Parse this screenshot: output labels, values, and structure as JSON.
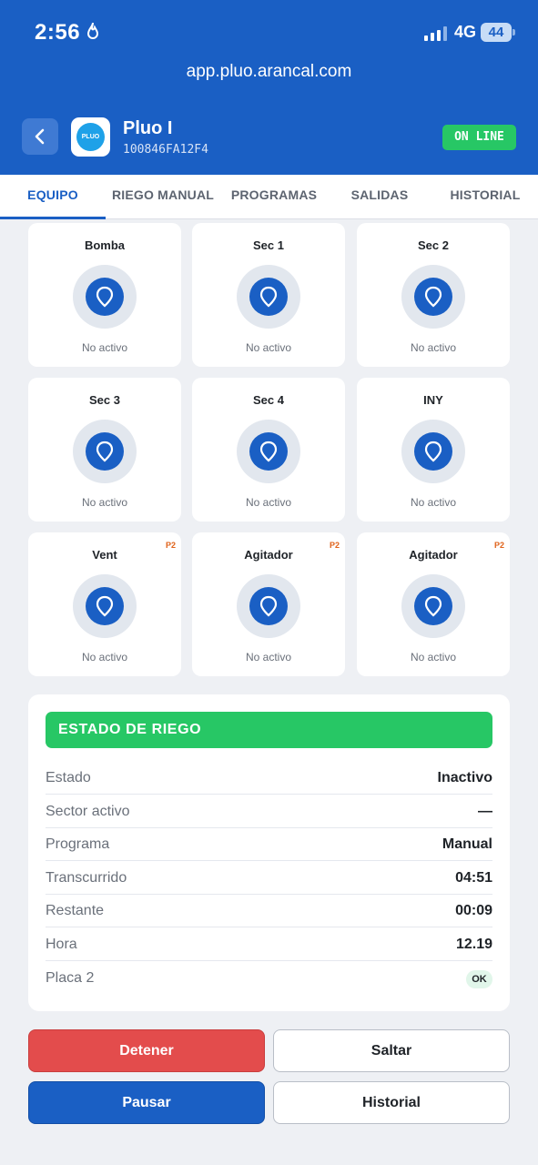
{
  "status_bar": {
    "time": "2:56",
    "network": "4G",
    "battery": "44"
  },
  "browser": {
    "url": "app.pluo.arancal.com"
  },
  "device": {
    "logo_text": "PLUO",
    "name": "Pluo I",
    "id": "100846FA12F4",
    "status": "ON LINE"
  },
  "tabs": [
    "EQUIPO",
    "RIEGO MANUAL",
    "PROGRAMAS",
    "SALIDAS",
    "HISTORIAL"
  ],
  "outputs": [
    {
      "name": "Bomba",
      "tag": "",
      "state": "No activo"
    },
    {
      "name": "Sec 1",
      "tag": "",
      "state": "No activo"
    },
    {
      "name": "Sec 2",
      "tag": "",
      "state": "No activo"
    },
    {
      "name": "Sec 3",
      "tag": "",
      "state": "No activo"
    },
    {
      "name": "Sec 4",
      "tag": "",
      "state": "No activo"
    },
    {
      "name": "INY",
      "tag": "",
      "state": "No activo"
    },
    {
      "name": "Vent",
      "tag": "P2",
      "state": "No activo"
    },
    {
      "name": "Agitador",
      "tag": "P2",
      "state": "No activo"
    },
    {
      "name": "Agitador",
      "tag": "P2",
      "state": "No activo"
    }
  ],
  "irrigation": {
    "title": "ESTADO DE RIEGO",
    "rows": [
      {
        "label": "Estado",
        "value": "Inactivo"
      },
      {
        "label": "Sector activo",
        "value": "—"
      },
      {
        "label": "Programa",
        "value": "Manual"
      },
      {
        "label": "Transcurrido",
        "value": "04:51"
      },
      {
        "label": "Restante",
        "value": "00:09"
      },
      {
        "label": "Hora",
        "value": "12.19"
      },
      {
        "label": "Placa 2",
        "value": "OK"
      }
    ]
  },
  "actions": {
    "stop": "Detener",
    "skip": "Saltar",
    "pause": "Pausar",
    "history": "Historial"
  },
  "colors": {
    "primary": "#1a5fc4",
    "online": "#27c765",
    "danger": "#e34c4c",
    "tag": "#e0621a"
  }
}
